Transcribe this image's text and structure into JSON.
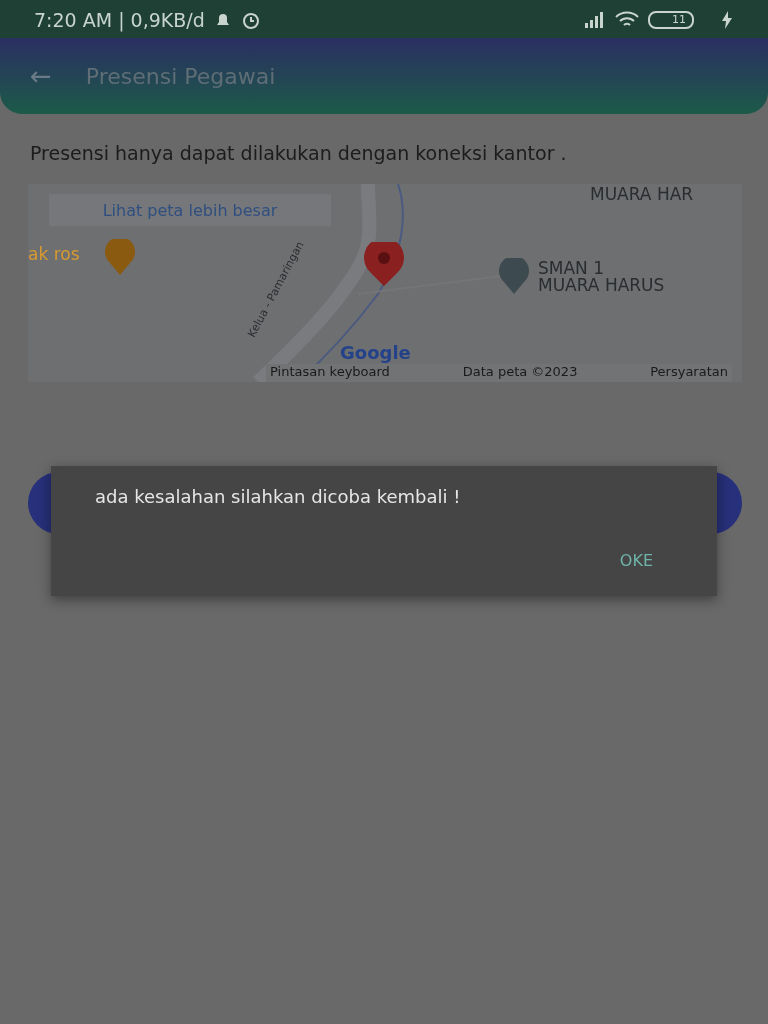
{
  "status_bar": {
    "time": "7:20 AM | 0,9KB/d",
    "battery": "11"
  },
  "app_bar": {
    "back": "←",
    "title": "Presensi Pegawai"
  },
  "notice": "Presensi hanya dapat dilakukan dengan koneksi kantor .",
  "map": {
    "enlarge_link": "Lihat peta lebih besar",
    "labels": [
      {
        "text": "MUARA HAR",
        "kind": "place"
      },
      {
        "text": "ak ros",
        "kind": "food"
      },
      {
        "text": "SMAN 1\nMUARA HARUS",
        "kind": "school"
      },
      {
        "text": "Kelua - Pamaringan",
        "kind": "road"
      }
    ],
    "logo": "Google",
    "footer": [
      "Pintasan keyboard",
      "Data peta ©2023",
      "Persyaratan"
    ]
  },
  "dialog": {
    "message": "ada kesalahan silahkan dicoba kembali !",
    "button": "OKE"
  }
}
